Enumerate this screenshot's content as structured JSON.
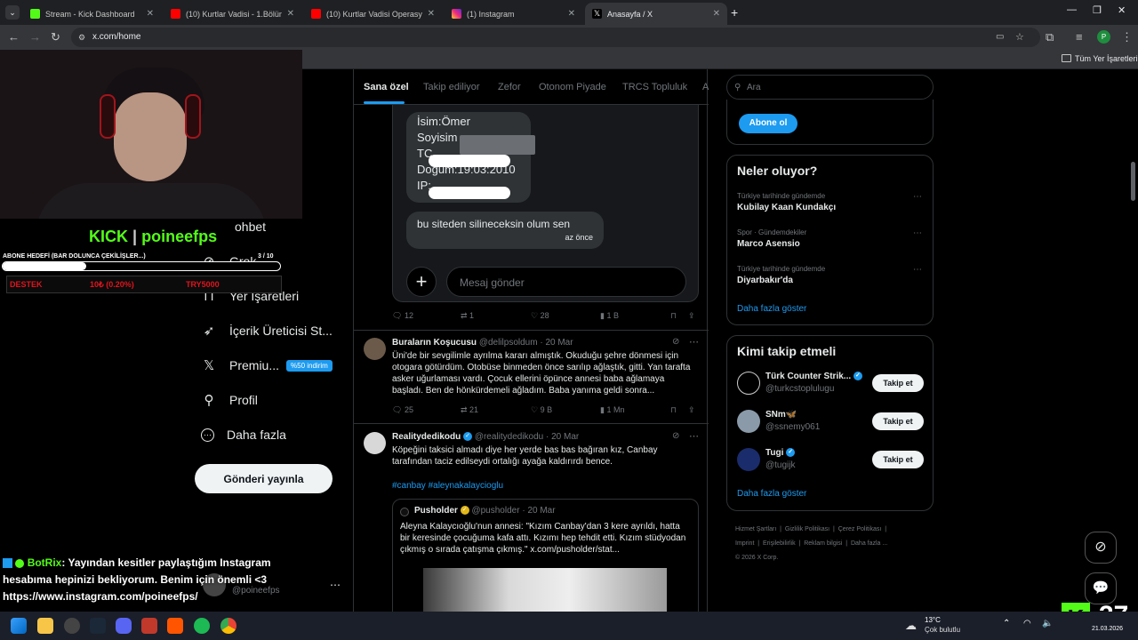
{
  "browser": {
    "tabs": [
      {
        "title": "Stream - Kick Dashboard",
        "color": "#53fc18"
      },
      {
        "title": "(10) Kurtlar Vadisi - 1.Bölüm | Fu",
        "color": "#ff0000"
      },
      {
        "title": "(10) Kurtlar Vadisi Operasyon M",
        "color": "#ff0000"
      },
      {
        "title": "(1) Instagram",
        "color": "#e1306c"
      },
      {
        "title": "Anasayfa / X",
        "color": "#ffffff"
      }
    ],
    "url": "x.com/home",
    "bookmarks_label": "Tüm Yer İşaretleri",
    "profile_initial": "P"
  },
  "x": {
    "tabs": [
      "Sana özel",
      "Takip ediliyor",
      "Zefor",
      "Otonom Piyade",
      "TRCS Topluluk",
      "A"
    ],
    "nav": [
      {
        "label": "ohbet",
        "icon": "chat-icon"
      },
      {
        "label": "Grok",
        "icon": "grok-icon"
      },
      {
        "label": "Yer İşaretleri",
        "icon": "bookmark-icon"
      },
      {
        "label": "İçerik Üreticisi St...",
        "icon": "rocket-icon"
      },
      {
        "label": "Premiu...",
        "icon": "x-logo-icon"
      },
      {
        "label": "Profil",
        "icon": "person-icon"
      },
      {
        "label": "Daha fazla",
        "icon": "more-circle-icon"
      }
    ],
    "premium_badge": "%50 indirim",
    "post_button": "Gönderi yayınla",
    "account": {
      "name": "poineefps",
      "handle": "@poineefps"
    },
    "dm": {
      "lines": [
        "İsim:Ömer",
        "Soyisim",
        "TC",
        "Doğum:19:03:2010",
        "IP:"
      ],
      "reply": "bu siteden silineceksin olum sen",
      "time": "az önce",
      "input_placeholder": "Mesaj gönder"
    },
    "tweet1_actions": {
      "replies": "12",
      "reposts": "1",
      "likes": "28",
      "views": "1 B"
    },
    "tweet2": {
      "name": "Buraların Koşucusu",
      "handle": "@delilpsoldum",
      "date": "20 Mar",
      "text": "Üni'de bir sevgilimle ayrılma kararı almıştık. Okuduğu şehre dönmesi için otogara götürdüm. Otobüse binmeden önce sarılıp ağlaştık, gitti. Yan tarafta asker uğurlaması vardı. Çocuk ellerini öpünce annesi baba ağlamaya başladı. Ben de hönkürdemeli ağladım. Baba yanıma geldi sonra...",
      "replies": "25",
      "reposts": "21",
      "likes": "9 B",
      "views": "1 Mn"
    },
    "tweet3": {
      "name": "Realitydedikodu",
      "handle": "@realitydedikodu",
      "date": "20 Mar",
      "text": "Köpeğini taksici almadı diye her yerde bas bas bağıran kız, Canbay tarafından taciz edilseydi ortalığı ayağa kaldırırdı bence.",
      "hashtags": "#canbay #aleynakalaycioglu"
    },
    "quote": {
      "name": "Pusholder",
      "handle": "@pusholder",
      "date": "20 Mar",
      "text": "Aleyna Kalaycıoğlu'nun annesi: \"Kızım Canbay'dan 3 kere ayrıldı, hatta bir keresinde çocuğuma kafa attı. Kızımı hep tehdit etti. Kızım stüdyodan çıkmış o sırada çatışma çıkmış.\" x.com/pusholder/stat..."
    },
    "search_placeholder": "Ara",
    "subscribe_button": "Abone ol",
    "trends_title": "Neler oluyor?",
    "trends": [
      {
        "category": "Türkiye tarihinde gündemde",
        "name": "Kubilay Kaan Kundakçı"
      },
      {
        "category": "Spor · Gündemdekiler",
        "name": "Marco Asensio"
      },
      {
        "category": "Türkiye tarihinde gündemde",
        "name": "Diyarbakır'da"
      }
    ],
    "show_more": "Daha fazla göster",
    "who_to_follow_title": "Kimi takip etmeli",
    "suggestions": [
      {
        "name": "Türk Counter Strik...",
        "handle": "@turkcstoplulugu",
        "button": "Takip et"
      },
      {
        "name": "SNm🦋",
        "handle": "@ssnemy061",
        "button": "Takip et"
      },
      {
        "name": "Tugi",
        "handle": "@tugijk",
        "button": "Takip et"
      }
    ],
    "footer": [
      "Hizmet Şartları",
      "Gizlilik Politikası",
      "Çerez Politikası",
      "Imprint",
      "Erişilebilirlik",
      "Reklam bilgisi",
      "Daha fazla ...",
      "© 2026 X Corp."
    ]
  },
  "overlay": {
    "brand": "KICK",
    "channel": "poineefps",
    "goal_label": "ABONE HEDEFİ (BAR DOLUNCA ÇEKİLİŞLER...)",
    "goal_count": "3 / 10",
    "goal_fraction": 0.3,
    "donate_label": "DESTEK",
    "donate_amount": "10₺ (0.20%)",
    "donate_target": "TRY5000",
    "chat_user": "BotRix",
    "chat_message": ": Yayından kesitler paylaştığım Instagram hesabıma hepinizi bekliyorum. Benim için önemli <3 https://www.instagram.com/poineefps/",
    "viewer_count": "37"
  },
  "taskbar": {
    "weather_temp": "13°C",
    "weather_desc": "Çok bulutlu",
    "date": "21.03.2026"
  }
}
